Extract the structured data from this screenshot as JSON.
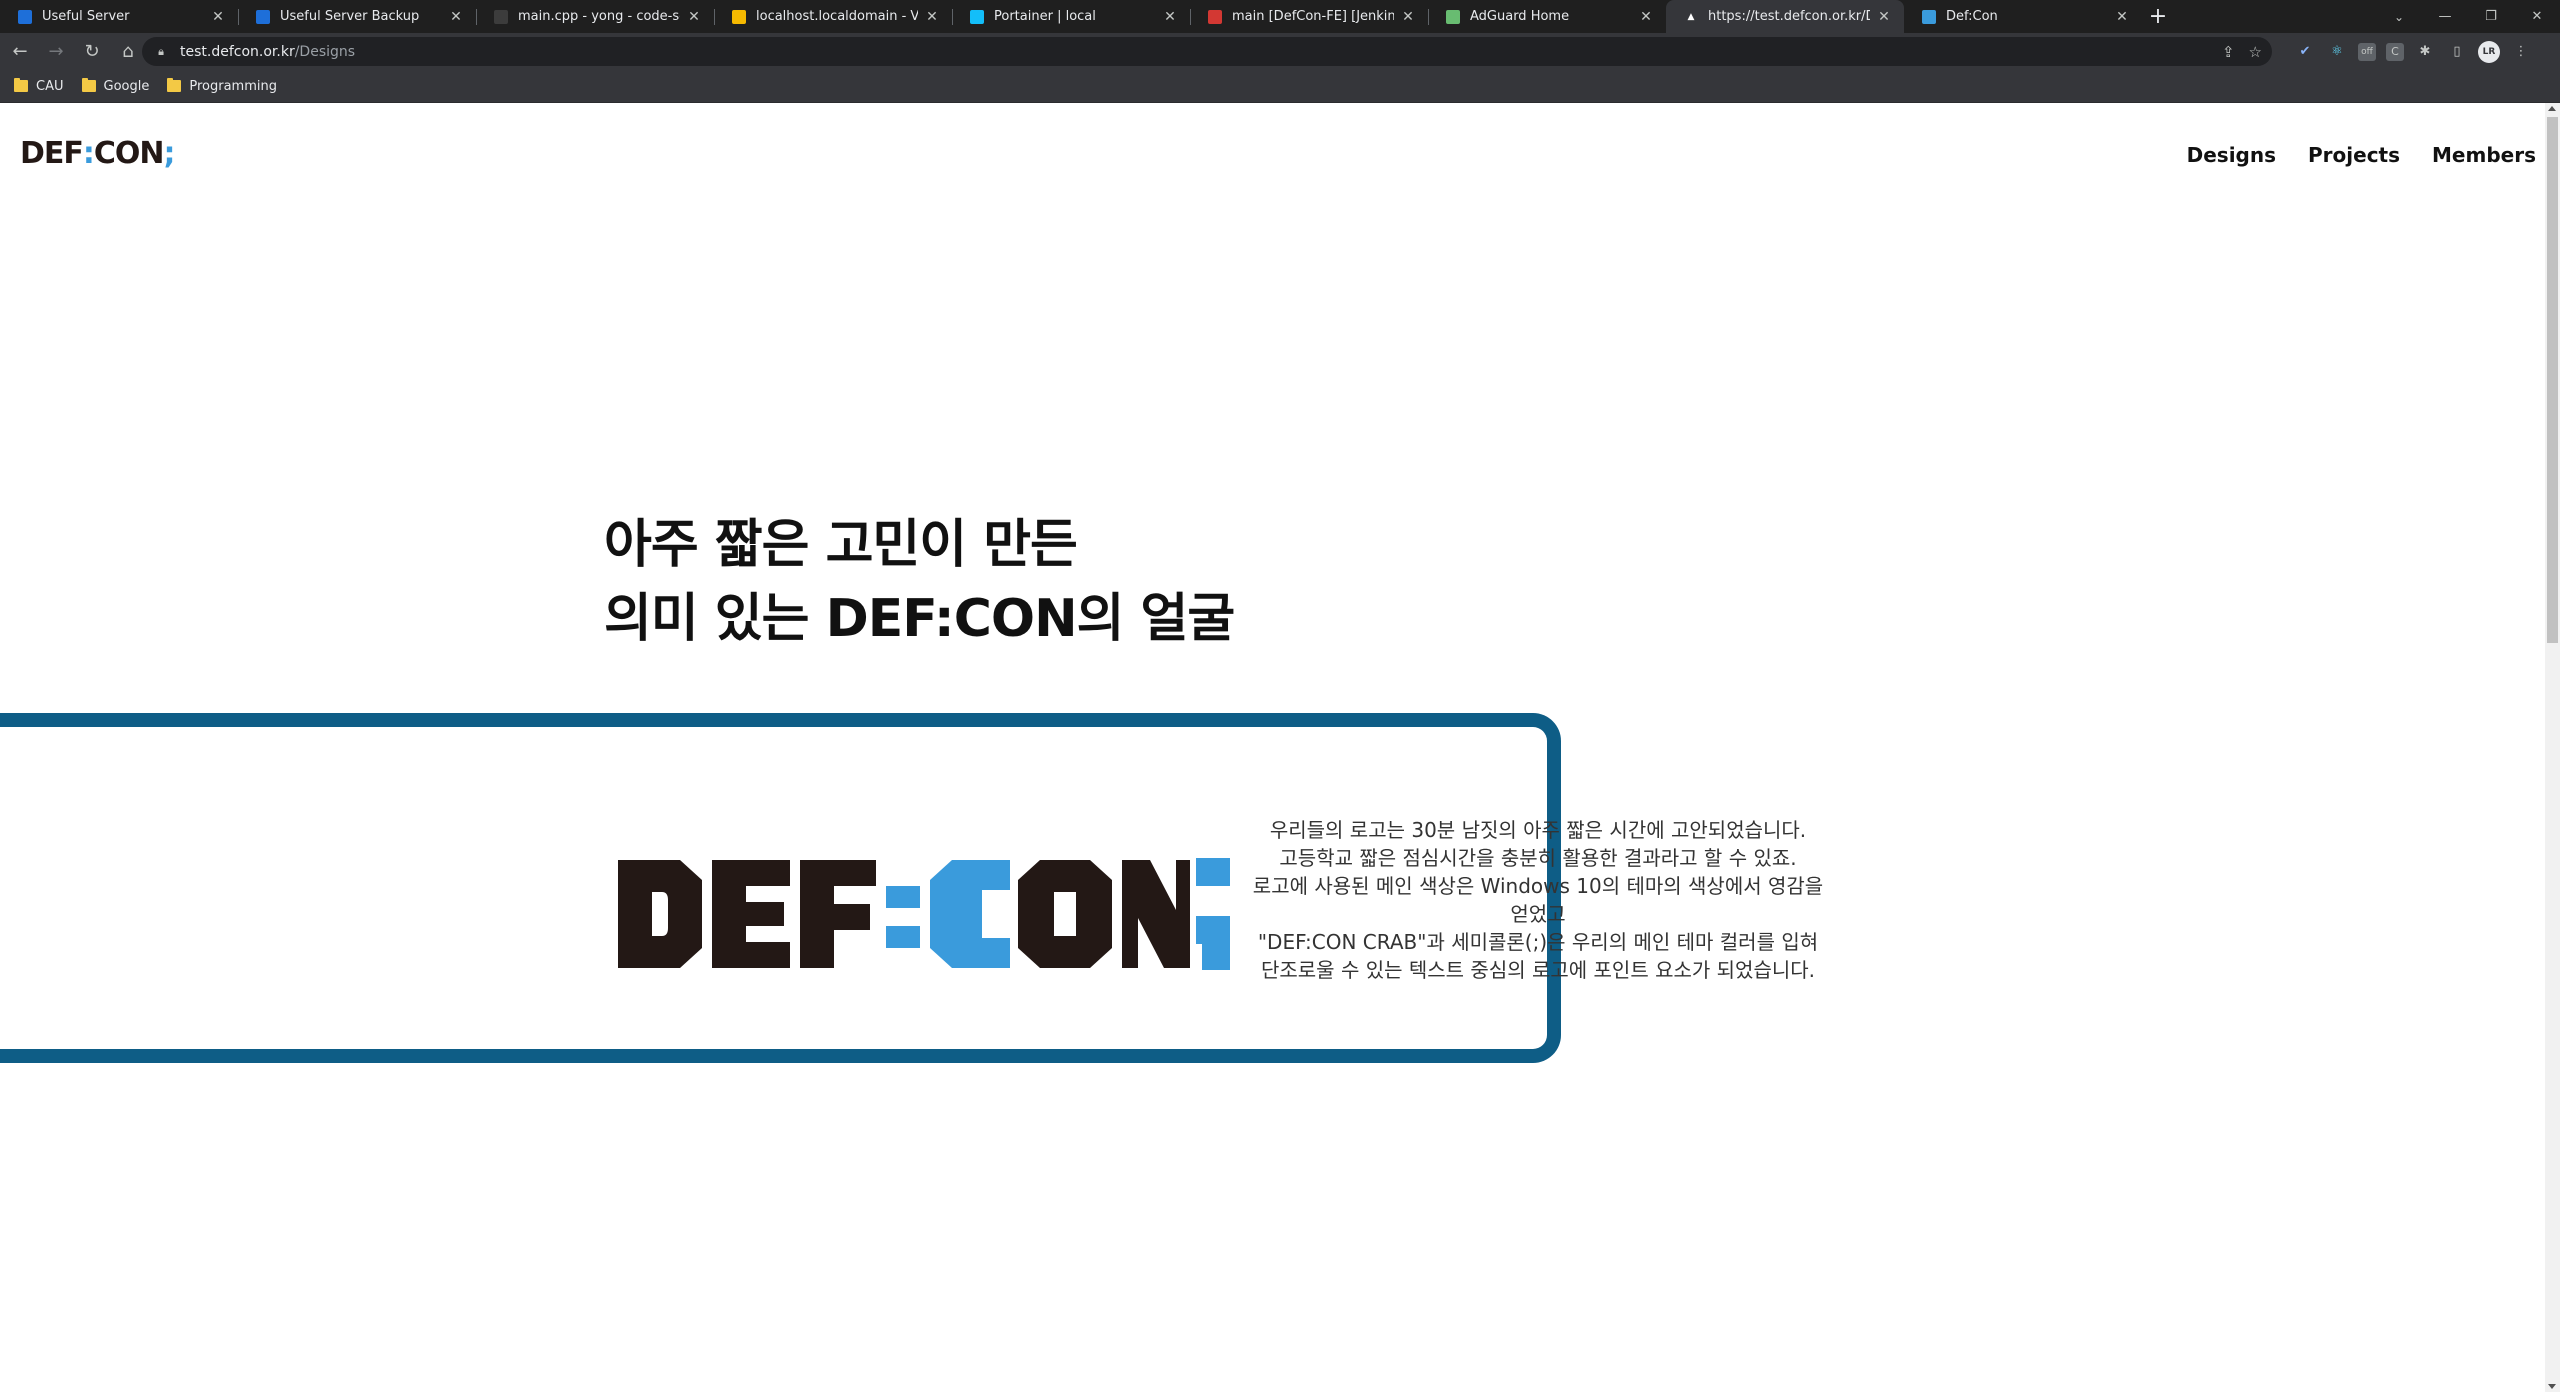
{
  "browser": {
    "tabs": [
      {
        "title": "Useful Server",
        "favicon": "dsm-icon",
        "favicon_color": "#1e6fd9",
        "active": false
      },
      {
        "title": "Useful Server Backup",
        "favicon": "dsm-icon",
        "favicon_color": "#1e6fd9",
        "active": false
      },
      {
        "title": "main.cpp - yong - code-server",
        "favicon": "code-server-icon",
        "favicon_color": "#3c3c3c",
        "active": false
      },
      {
        "title": "localhost.localdomain - VMware",
        "favicon": "vmware-icon",
        "favicon_color": "#f6b900",
        "active": false
      },
      {
        "title": "Portainer | local",
        "favicon": "portainer-icon",
        "favicon_color": "#13bef9",
        "active": false
      },
      {
        "title": "main [DefCon-FE] [Jenkins]",
        "favicon": "jenkins-icon",
        "favicon_color": "#d33833",
        "active": false
      },
      {
        "title": "AdGuard Home",
        "favicon": "adguard-icon",
        "favicon_color": "#68bc71",
        "active": false
      },
      {
        "title": "https://test.defcon.or.kr/Designs",
        "favicon": "triangle-icon",
        "favicon_color": "#ffffff",
        "active": true
      },
      {
        "title": "Def:Con",
        "favicon": "defcon-icon",
        "favicon_color": "#3a9bdc",
        "active": false
      }
    ],
    "url_host": "test.defcon.or.kr",
    "url_path": "/Designs",
    "bookmarks": [
      "CAU",
      "Google",
      "Programming"
    ],
    "avatar_initials": "LR"
  },
  "site": {
    "logo_left": "DEF",
    "logo_colon": ":",
    "logo_mid": "CON",
    "logo_semi": ";",
    "nav": [
      "Designs",
      "Projects",
      "Members"
    ],
    "headline_line1": "아주 짧은 고민이 만든",
    "headline_line2": "의미 있는 DEF:CON의 얼굴",
    "big_logo_text": "DEF:CON;",
    "description": [
      "우리들의 로고는 30분 남짓의 아주 짧은 시간에 고안되었습니다.",
      "고등학교 짧은 점심시간을 충분히 활용한 결과라고 할 수 있죠.",
      "로고에 사용된 메인 색상은 Windows 10의 테마의 색상에서 영감을 얻었고",
      "\"DEF:CON CRAB\"과 세미콜론(;)은 우리의 메인 테마 컬러를 입혀",
      "단조로울 수 있는 텍스트 중심의 로고에 포인트 요소가 되었습니다."
    ]
  },
  "colors": {
    "brand_dark": "#231815",
    "brand_blue": "#3a9bdc",
    "frame": "#0e5d86"
  }
}
